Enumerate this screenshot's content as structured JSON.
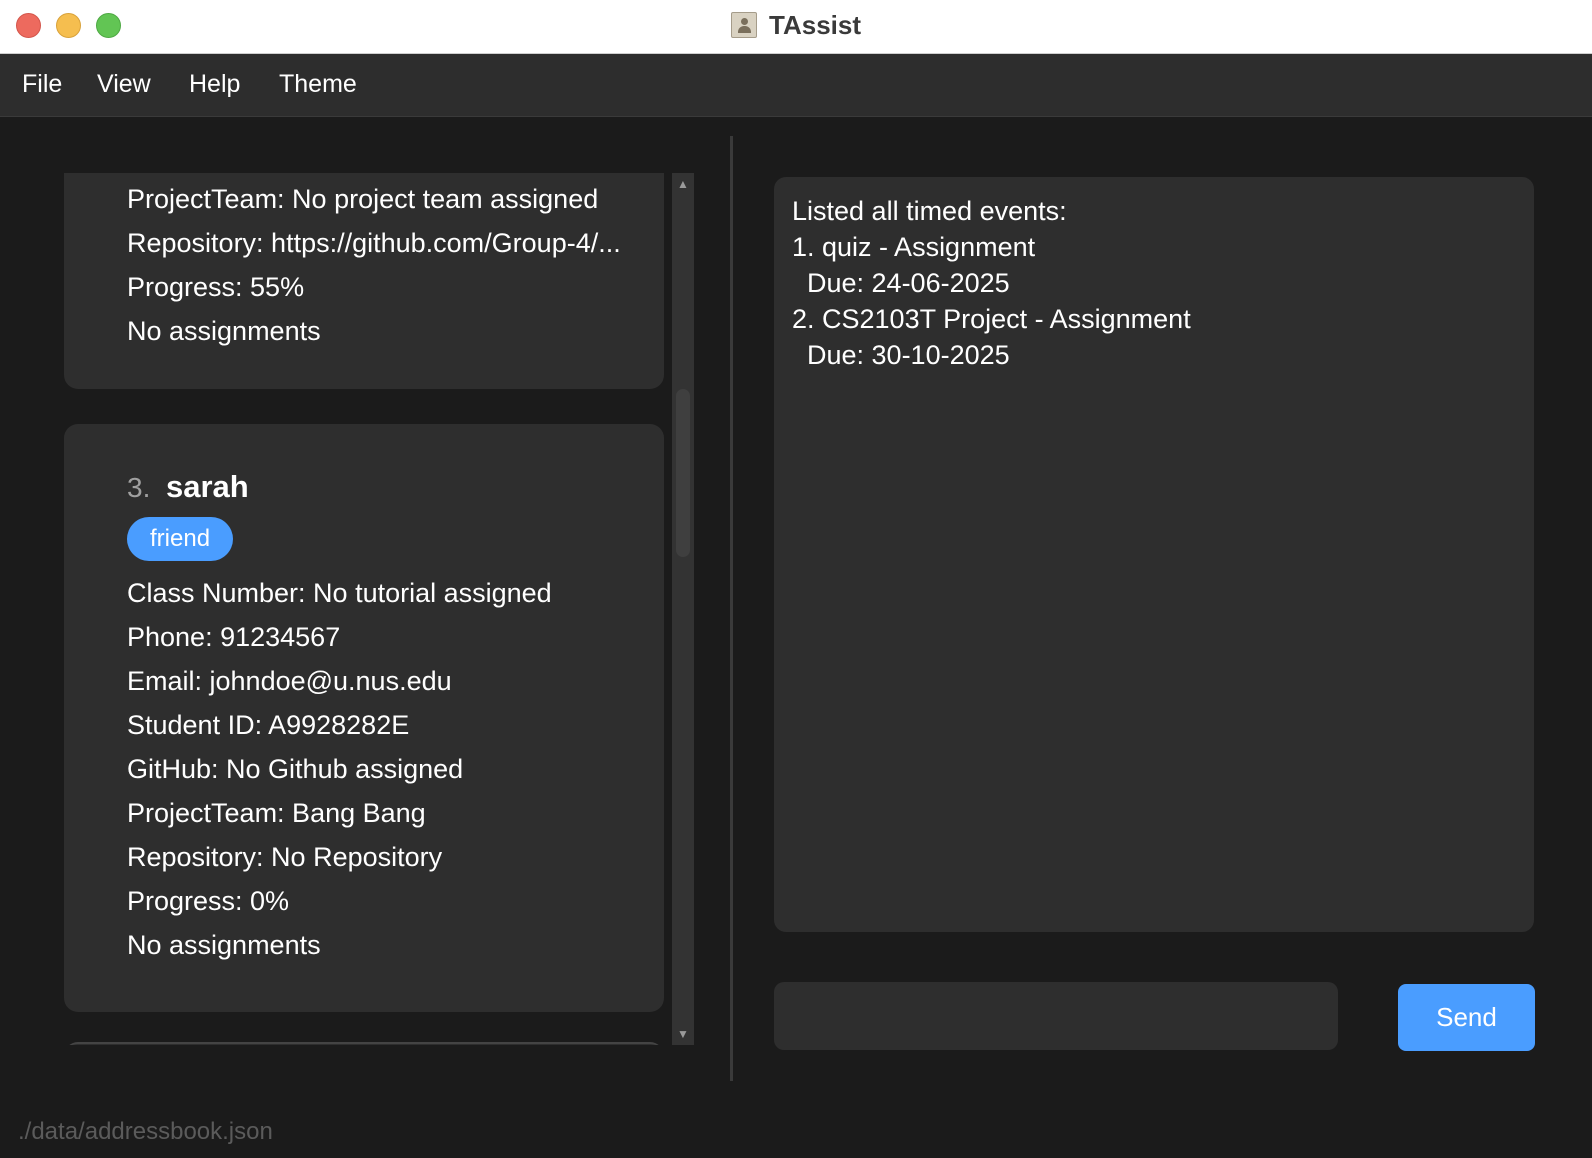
{
  "window": {
    "title": "TAssist"
  },
  "menu": {
    "items": [
      "File",
      "View",
      "Help",
      "Theme"
    ]
  },
  "person_list": {
    "card1": {
      "project_team": "ProjectTeam: No project team assigned",
      "repository": "Repository: https://github.com/Group-4/...",
      "progress": "Progress: 55%",
      "assignments": "No assignments"
    },
    "card2": {
      "index": "3.",
      "name": "sarah",
      "tag": "friend",
      "class_number": "Class Number: No tutorial assigned",
      "phone": "Phone: 91234567",
      "email": "Email: johndoe@u.nus.edu",
      "student_id": "Student ID: A9928282E",
      "github": "GitHub: No Github assigned",
      "project_team": "ProjectTeam: Bang Bang",
      "repository": "Repository: No Repository",
      "progress": "Progress: 0%",
      "assignments": "No assignments"
    }
  },
  "result": {
    "lines": [
      "Listed all timed events:",
      "1. quiz - Assignment",
      "  Due: 24-06-2025",
      "2. CS2103T Project - Assignment",
      "  Due: 30-10-2025"
    ]
  },
  "command": {
    "value": "",
    "send_label": "Send"
  },
  "status": {
    "path": "./data/addressbook.json"
  },
  "colors": {
    "background": "#1b1b1b",
    "panel": "#2e2e2e",
    "accent": "#4a9dff",
    "titlebar": "#ffffff"
  }
}
